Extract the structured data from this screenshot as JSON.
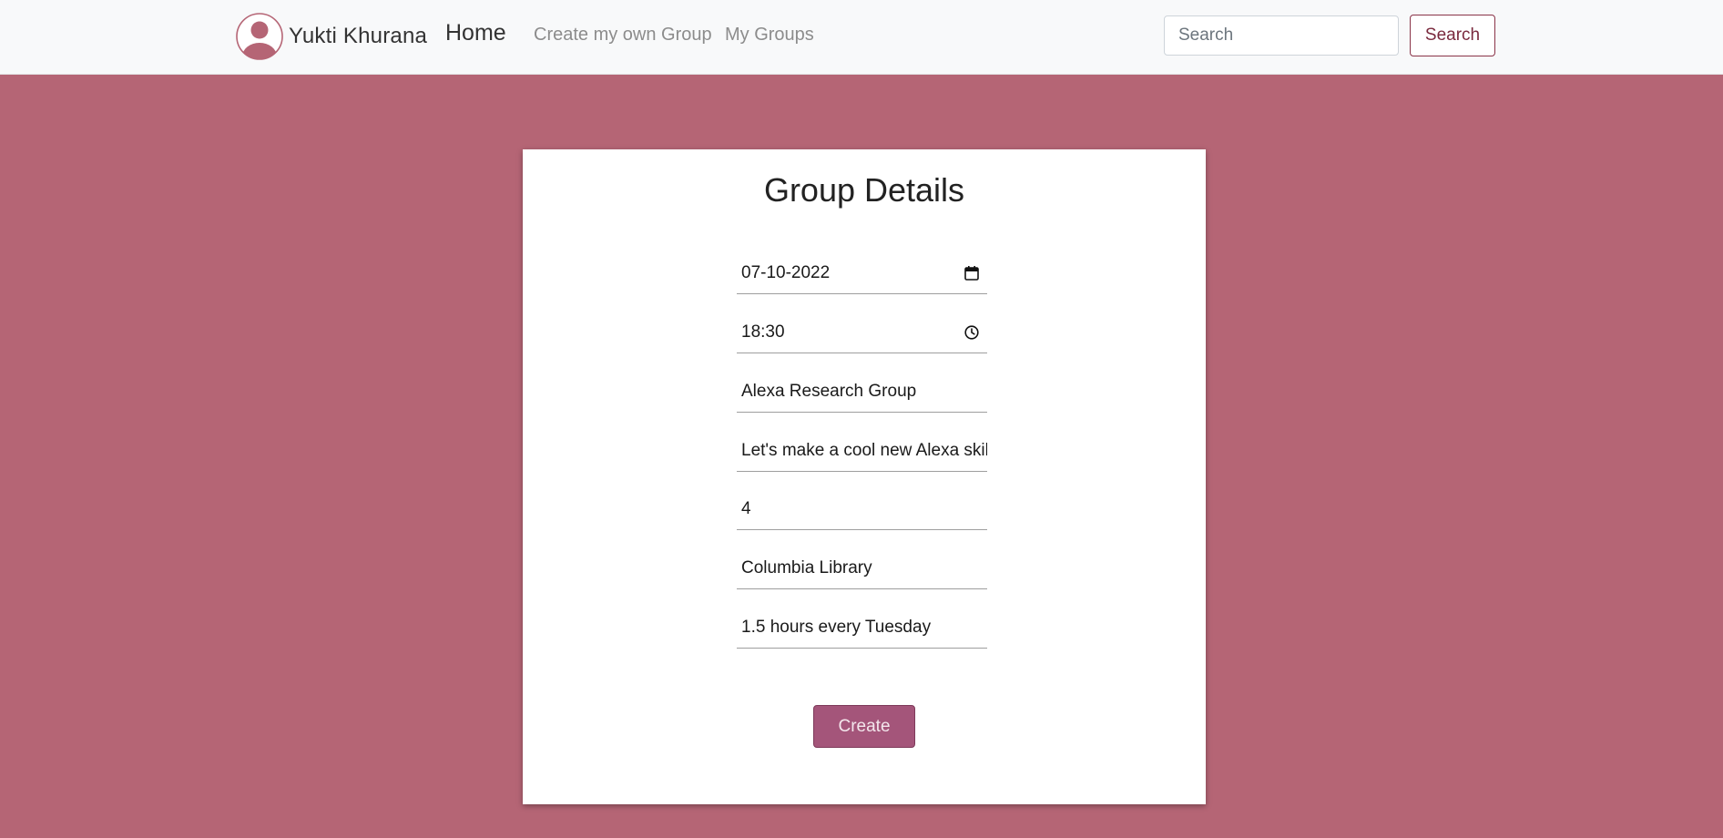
{
  "navbar": {
    "user_name": "Yukti Khurana",
    "avatar_icon": "user-avatar-icon",
    "home_label": "Home",
    "links": [
      "Create my own Group",
      "My Groups"
    ],
    "search_placeholder": "Search",
    "search_button_label": "Search"
  },
  "colors": {
    "page_background": "#b56575",
    "navbar_background": "#f8f9fa",
    "accent": "#a4557a",
    "search_button_border": "#8a3348"
  },
  "form": {
    "title": "Group Details",
    "fields": [
      {
        "value": "07-10-2022",
        "icon": "calendar-icon"
      },
      {
        "value": "18:30",
        "icon": "clock-icon"
      },
      {
        "value": "Alexa Research Group"
      },
      {
        "value": "Let's make a cool new Alexa skil"
      },
      {
        "value": "4"
      },
      {
        "value": "Columbia Library"
      },
      {
        "value": "1.5 hours every Tuesday"
      }
    ],
    "submit_label": "Create"
  }
}
